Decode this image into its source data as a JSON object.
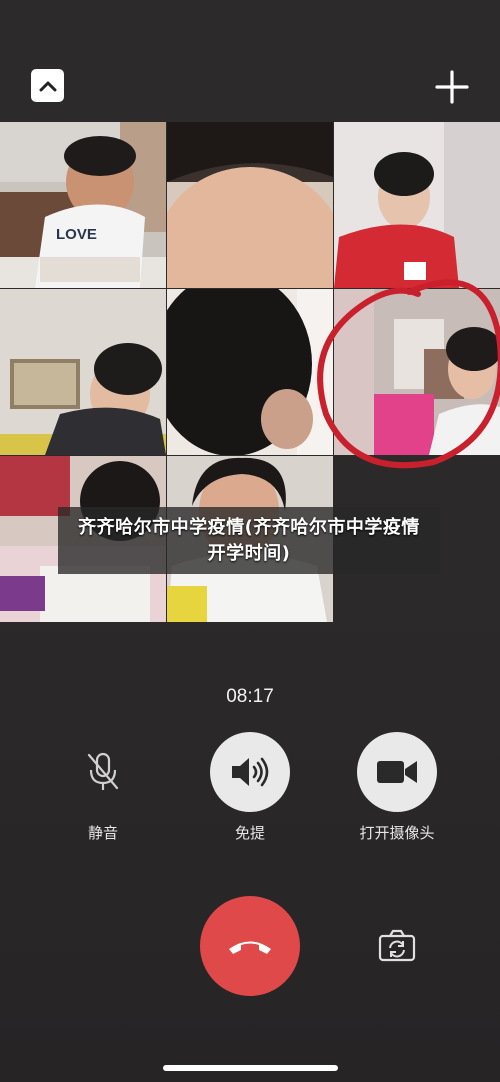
{
  "top_bar": {
    "collapse_icon": "chevron-up-icon",
    "add_icon": "plus-icon"
  },
  "participants": [
    {
      "id": "p1",
      "shirt_text": "LOVE"
    },
    {
      "id": "p2"
    },
    {
      "id": "p3"
    },
    {
      "id": "p4"
    },
    {
      "id": "p5"
    },
    {
      "id": "p6"
    },
    {
      "id": "p7"
    },
    {
      "id": "p8"
    }
  ],
  "caption": {
    "text": "齐齐哈尔市中学疫情(齐齐哈尔市中学疫情开学时间)"
  },
  "call": {
    "timer": "08:17"
  },
  "controls": {
    "mute_label": "静音",
    "speaker_label": "免提",
    "camera_label": "打开摄像头"
  },
  "colors": {
    "background": "#2b2929",
    "hangup": "#e0494a",
    "button_fill": "#e9e9ea",
    "annotation": "#c8202c"
  }
}
